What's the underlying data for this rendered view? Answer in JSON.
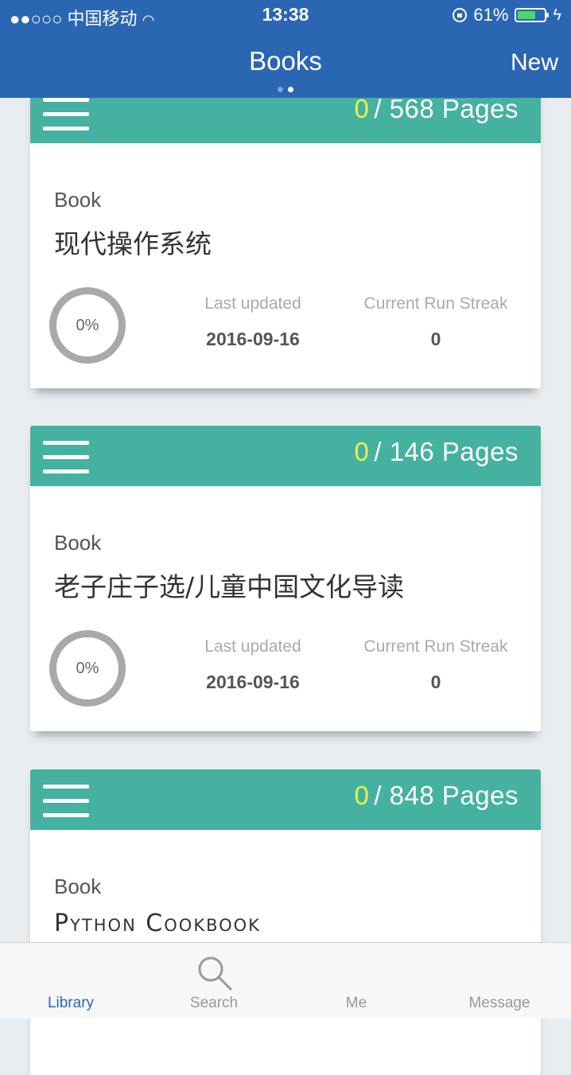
{
  "status_bar": {
    "carrier": "●●○○○ 中国移动",
    "wifi_icon": "wifi-icon",
    "time": "13:38",
    "battery_percent": "61%",
    "battery_level": 0.61
  },
  "nav": {
    "title": "Books",
    "new_label": "New",
    "page_index": 2,
    "page_count": 2
  },
  "colors": {
    "nav_bar": "#2b66b3",
    "card_header": "#45b1a0",
    "page_current": "#e9f24a",
    "tab_active": "#2b66b3"
  },
  "books": [
    {
      "current_page": "0",
      "total_pages": "/ 568 Pages",
      "category": "Book",
      "title": "现代操作系统",
      "progress": "0%",
      "last_updated_label": "Last updated",
      "last_updated": "2016-09-16",
      "streak_label": "Current Run Streak",
      "streak": "0"
    },
    {
      "current_page": "0",
      "total_pages": "/ 146 Pages",
      "category": "Book",
      "title": "老子庄子选/儿童中国文化导读",
      "progress": "0%",
      "last_updated_label": "Last updated",
      "last_updated": "2016-09-16",
      "streak_label": "Current Run Streak",
      "streak": "0"
    },
    {
      "current_page": "0",
      "total_pages": "/ 848 Pages",
      "category": "Book",
      "title": "Python Cookbook"
    }
  ],
  "tabs": [
    {
      "label": "Library",
      "active": true
    },
    {
      "label": "Search",
      "icon": "search-icon"
    },
    {
      "label": "Me"
    },
    {
      "label": "Message"
    }
  ]
}
